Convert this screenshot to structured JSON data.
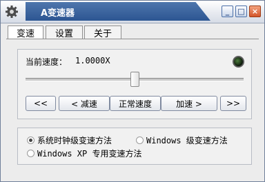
{
  "window": {
    "title": "A变速器",
    "icon": "gear-icon",
    "controls": {
      "minimize": "_",
      "maximize": "□",
      "close": "×"
    }
  },
  "tabs": [
    {
      "label": "变速",
      "active": true
    },
    {
      "label": "设置",
      "active": false
    },
    {
      "label": "关于",
      "active": false
    }
  ],
  "speed": {
    "label": "当前速度：",
    "value": "1.0000X",
    "slider_level": 0.5
  },
  "buttons": {
    "fastest_slower": "<<",
    "slower": "< 减速",
    "normal": "正常速度",
    "faster": "加速 >",
    "fastest_faster": ">>"
  },
  "methods": [
    {
      "label": "系统时钟级变速方法",
      "checked": true
    },
    {
      "label": "Windows 级变速方法",
      "checked": false
    },
    {
      "label": "Windows XP 专用变速方法",
      "checked": false
    }
  ],
  "colors": {
    "title_bar": "#2c5592",
    "close_button": "#d2552a",
    "indicator": "#0c160a"
  }
}
